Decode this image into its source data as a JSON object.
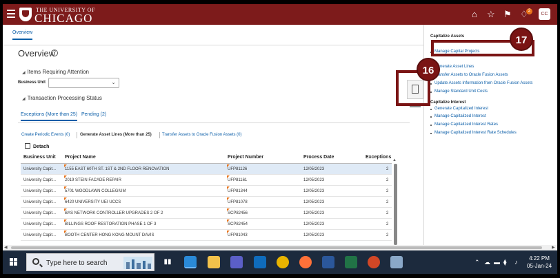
{
  "header": {
    "logo_top": "THE UNIVERSITY OF",
    "logo_main": "CHICAGO",
    "notification_count": "2",
    "avatar_initials": "CC"
  },
  "tabs": {
    "overview": "Overview"
  },
  "main": {
    "title": "Overview",
    "items_section": "Items Requiring Attention",
    "business_unit_label": "Business Unit",
    "business_unit_value": "",
    "transaction_section": "Transaction Processing Status",
    "subtabs": [
      "Exceptions (More than 25)",
      "Pending (2)"
    ],
    "links": [
      "Create Periodic Events (0)",
      "Generate Asset Lines (More than 25)",
      "Transfer Assets to Oracle Fusion Assets (0)"
    ],
    "detach": "Detach",
    "table": {
      "headers": [
        "Business Unit",
        "Project Name",
        "Project Number",
        "Process Date",
        "Exceptions"
      ],
      "rows": [
        [
          "University Capit...",
          "1155 EAST 60TH ST. 1ST & 2ND FLOOR RENOVATION",
          "UFP81126",
          "12/05/2023",
          "2"
        ],
        [
          "University Capit...",
          "2019 STEIN FACADE REPAIR",
          "UFP81161",
          "12/05/2023",
          "2"
        ],
        [
          "University Capit...",
          "5701 WOODLAWN COLLEGIUM",
          "UFP81344",
          "12/05/2023",
          "2"
        ],
        [
          "University Capit...",
          "6420 UNIVERSITY UEI UCCS",
          "UFP81078",
          "12/05/2023",
          "2"
        ],
        [
          "University Capit...",
          "BAS NETWORK CONTROLLER UPGRADES 2 OF 2",
          "SCP82456",
          "12/05/2023",
          "2"
        ],
        [
          "University Capit...",
          "BILLINGS ROOF RESTORATION PHASE 1 OF 3",
          "SCP82454",
          "12/05/2023",
          "2"
        ],
        [
          "University Capit...",
          "BOOTH CENTER HONG KONG MOUNT DAVIS",
          "UFP81043",
          "12/05/2023",
          "2"
        ]
      ]
    }
  },
  "right_panel": {
    "capitalize_assets": "Capitalize Assets",
    "asset_links": [
      "Manage Capital Projects",
      "Generate Asset Lines",
      "Transfer Assets to Oracle Fusion Assets",
      "Update Assets Information from Oracle Fusion Assets",
      "Manage Standard Unit Costs"
    ],
    "capitalize_interest": "Capitalize Interest",
    "interest_links": [
      "Generate Capitalized Interest",
      "Manage Capitalized Interest",
      "Manage Capitalized Interest Rates",
      "Manage Capitalized Interest Rate Schedules"
    ]
  },
  "callouts": {
    "c16": "16",
    "c17": "17"
  },
  "taskbar": {
    "search_placeholder": "Type here to search",
    "time": "4:22 PM",
    "date": "05-Jan-24"
  },
  "colors": {
    "header": "#7d1b1b",
    "link": "#0b5ea8",
    "callout": "#7a1414",
    "taskbar": "#1c2a3d"
  }
}
